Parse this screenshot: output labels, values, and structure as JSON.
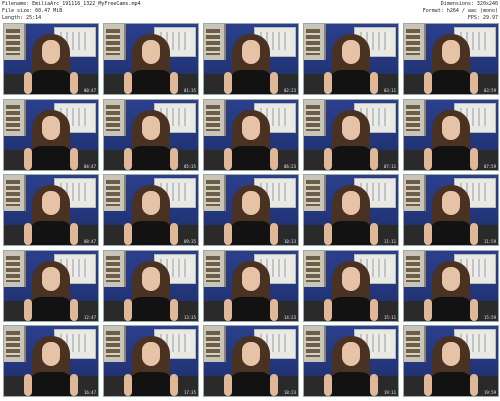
{
  "info": {
    "filename": "Filename: EmiliaArc_191116_1322_MyFreeCams.mp4",
    "filesize": "File size: 60.47 MiB",
    "length": "Length: 25:14",
    "dimensions": "Dimensions: 320x240",
    "format": "Format: h264 / aac (mono)",
    "fps": "FPS: 29.97"
  },
  "thumbnails": [
    {
      "time": "00:47"
    },
    {
      "time": "01:35"
    },
    {
      "time": "02:23"
    },
    {
      "time": "03:11"
    },
    {
      "time": "03:59"
    },
    {
      "time": "04:47"
    },
    {
      "time": "05:35"
    },
    {
      "time": "06:23"
    },
    {
      "time": "07:11"
    },
    {
      "time": "07:59"
    },
    {
      "time": "08:47"
    },
    {
      "time": "09:35"
    },
    {
      "time": "10:23"
    },
    {
      "time": "11:11"
    },
    {
      "time": "11:59"
    },
    {
      "time": "12:47"
    },
    {
      "time": "13:35"
    },
    {
      "time": "14:23"
    },
    {
      "time": "15:11"
    },
    {
      "time": "15:59"
    },
    {
      "time": "16:47"
    },
    {
      "time": "17:35"
    },
    {
      "time": "18:23"
    },
    {
      "time": "19:11"
    },
    {
      "time": "19:59"
    }
  ]
}
